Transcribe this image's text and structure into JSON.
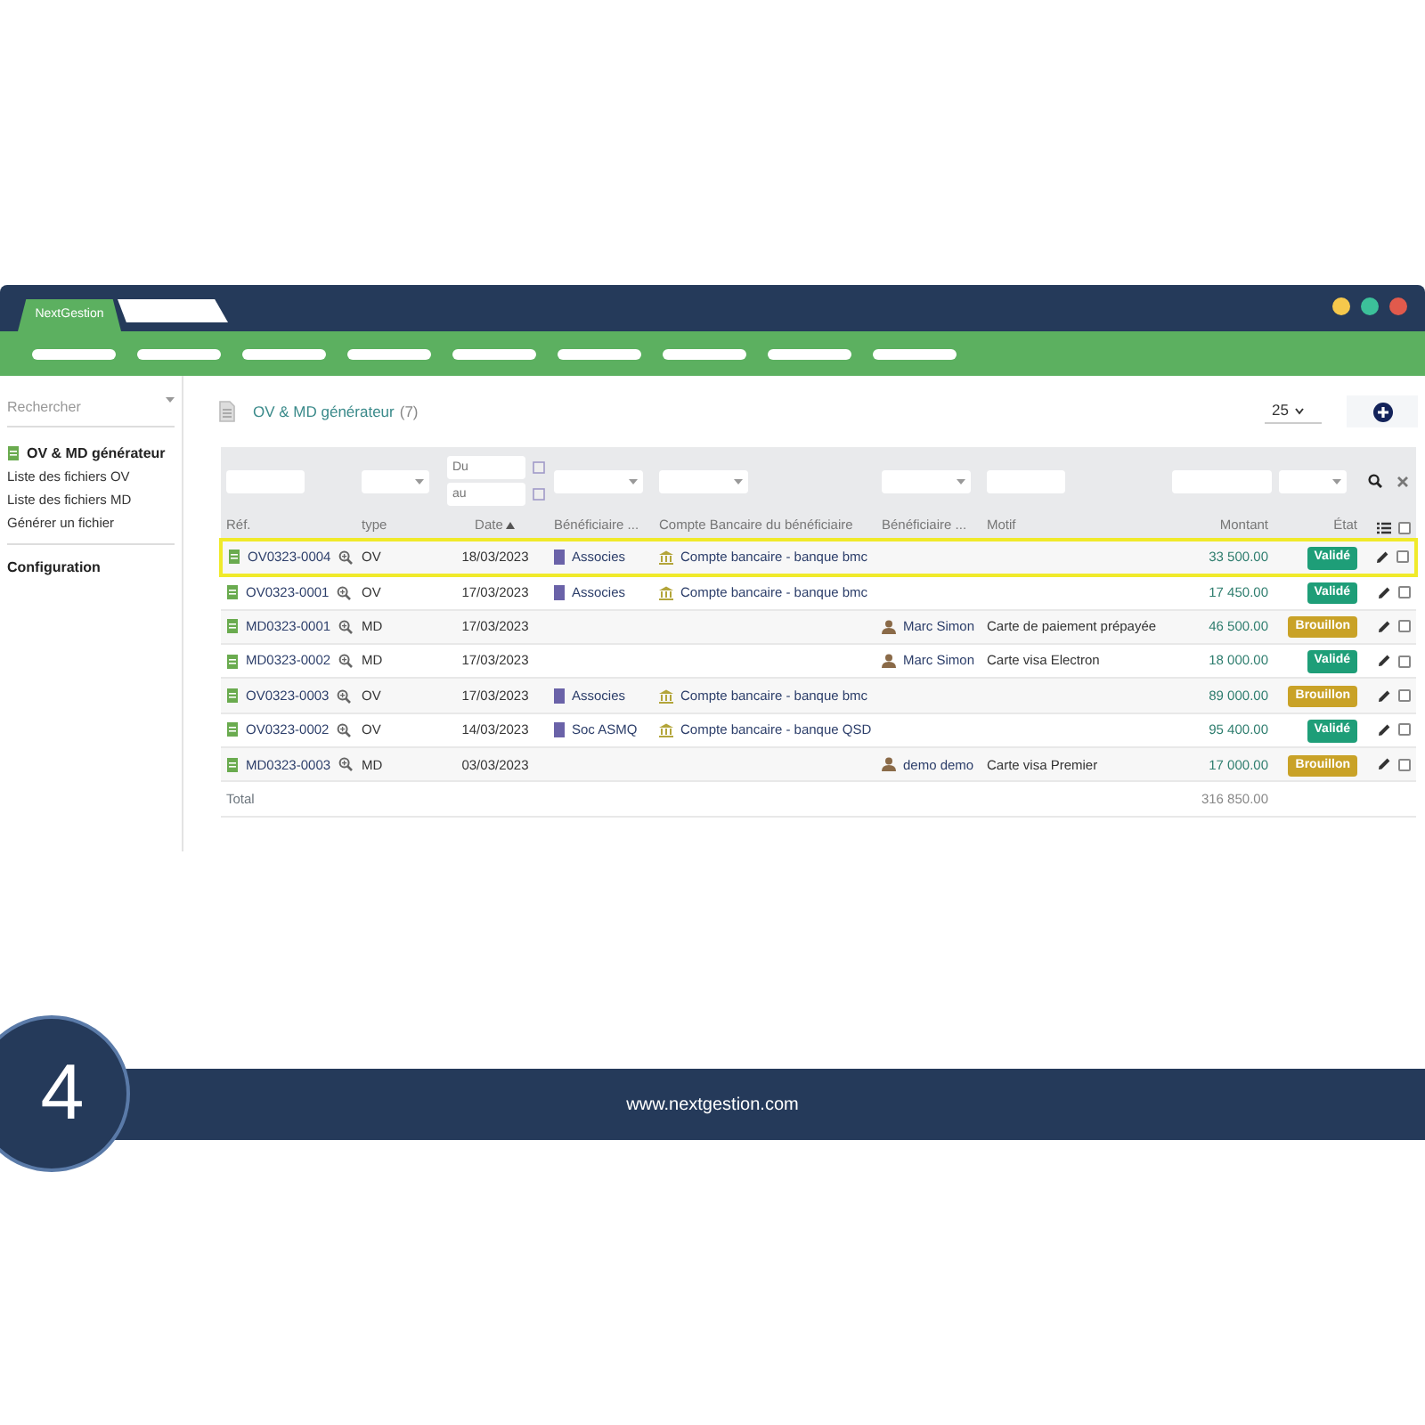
{
  "app_tab": {
    "label": "NextGestion"
  },
  "sidebar": {
    "search": {
      "placeholder": "Rechercher"
    },
    "items": [
      {
        "label": "OV & MD générateur",
        "kind": "section"
      },
      {
        "label": "Liste des fichiers OV",
        "kind": "link"
      },
      {
        "label": "Liste des fichiers MD",
        "kind": "link"
      },
      {
        "label": "Générer un fichier",
        "kind": "link"
      },
      {
        "label": "Configuration",
        "kind": "heading"
      }
    ]
  },
  "page": {
    "title": "OV & MD générateur",
    "count": "(7)",
    "per_page": "25"
  },
  "filters": {
    "date_from": {
      "placeholder": "Du"
    },
    "date_to": {
      "placeholder": "au"
    }
  },
  "table": {
    "columns": [
      {
        "label": "Réf.",
        "sorted": false
      },
      {
        "label": "type",
        "sorted": false
      },
      {
        "label": "Date",
        "sorted": true
      },
      {
        "label": "Bénéficiaire ...",
        "sorted": false
      },
      {
        "label": "Compte Bancaire du bénéficiaire",
        "sorted": false
      },
      {
        "label": "Bénéficiaire ...",
        "sorted": false
      },
      {
        "label": "Motif",
        "sorted": false
      },
      {
        "label": "Montant",
        "sorted": false
      },
      {
        "label": "État",
        "sorted": false
      }
    ],
    "rows": [
      {
        "ref": "OV0323-0004",
        "type": "OV",
        "date": "18/03/2023",
        "beneficiary": {
          "name": "Associes",
          "kind": "company"
        },
        "account": "Compte bancaire - banque bmc",
        "amount": "33 500.00",
        "status": {
          "label": "Validé",
          "kind": "valid"
        },
        "highlighted": true,
        "checked": false
      },
      {
        "ref": "OV0323-0001",
        "type": "OV",
        "date": "17/03/2023",
        "beneficiary": {
          "name": "Associes",
          "kind": "company"
        },
        "account": "Compte bancaire - banque bmc",
        "amount": "17 450.00",
        "status": {
          "label": "Validé",
          "kind": "valid"
        },
        "highlighted": false,
        "checked": false
      },
      {
        "ref": "MD0323-0001",
        "type": "MD",
        "date": "17/03/2023",
        "beneficiary": {
          "name": "Marc Simon",
          "kind": "person"
        },
        "motif": "Carte de paiement prépayée",
        "amount": "46 500.00",
        "status": {
          "label": "Brouillon",
          "kind": "draft"
        },
        "highlighted": false,
        "checked": false
      },
      {
        "ref": "MD0323-0002",
        "type": "MD",
        "date": "17/03/2023",
        "beneficiary": {
          "name": "Marc Simon",
          "kind": "person"
        },
        "motif": "Carte visa Electron",
        "amount": "18 000.00",
        "status": {
          "label": "Validé",
          "kind": "valid"
        },
        "highlighted": false,
        "checked": false
      },
      {
        "ref": "OV0323-0003",
        "type": "OV",
        "date": "17/03/2023",
        "beneficiary": {
          "name": "Associes",
          "kind": "company"
        },
        "account": "Compte bancaire - banque bmc",
        "amount": "89 000.00",
        "status": {
          "label": "Brouillon",
          "kind": "draft"
        },
        "highlighted": false,
        "checked": false
      },
      {
        "ref": "OV0323-0002",
        "type": "OV",
        "date": "14/03/2023",
        "beneficiary": {
          "name": "Soc ASMQ",
          "kind": "company"
        },
        "account": "Compte bancaire - banque QSD",
        "amount": "95 400.00",
        "status": {
          "label": "Validé",
          "kind": "valid"
        },
        "highlighted": false,
        "checked": false
      },
      {
        "ref": "MD0323-0003",
        "type": "MD",
        "date": "03/03/2023",
        "beneficiary": {
          "name": "demo demo",
          "kind": "person"
        },
        "motif": "Carte visa Premier",
        "amount": "17 000.00",
        "status": {
          "label": "Brouillon",
          "kind": "draft"
        },
        "highlighted": false,
        "checked": false
      }
    ],
    "total": {
      "label": "Total",
      "amount": "316 850.00"
    },
    "select_all_checked": false
  },
  "footer": {
    "step": "4",
    "url": "www.nextgestion.com"
  }
}
